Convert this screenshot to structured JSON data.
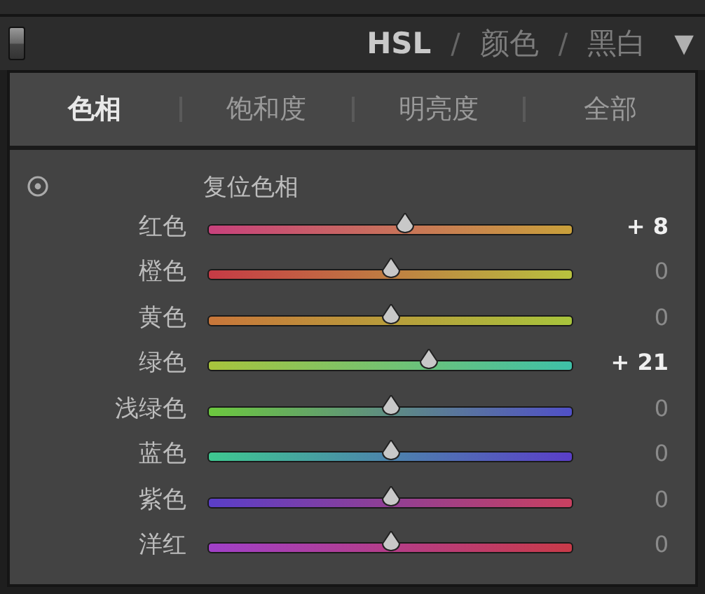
{
  "header": {
    "panel_switch": {
      "on": true
    },
    "modes": [
      {
        "label": "HSL",
        "selected": true
      },
      {
        "label": "颜色",
        "selected": false
      },
      {
        "label": "黑白",
        "selected": false
      }
    ],
    "separator": "/",
    "collapse_glyph": "▼"
  },
  "tabs": [
    {
      "label": "色相",
      "selected": true
    },
    {
      "label": "饱和度",
      "selected": false
    },
    {
      "label": "明亮度",
      "selected": false
    },
    {
      "label": "全部",
      "selected": false
    }
  ],
  "section": {
    "title": "复位色相"
  },
  "channels": [
    {
      "name": "红色",
      "level": 0.54,
      "reading": "+ 8",
      "changed": true
    },
    {
      "name": "橙色",
      "level": 0.5,
      "reading": "0",
      "changed": false
    },
    {
      "name": "黄色",
      "level": 0.5,
      "reading": "0",
      "changed": false
    },
    {
      "name": "绿色",
      "level": 0.605,
      "reading": "+ 21",
      "changed": true
    },
    {
      "name": "浅绿色",
      "level": 0.5,
      "reading": "0",
      "changed": false
    },
    {
      "name": "蓝色",
      "level": 0.5,
      "reading": "0",
      "changed": false
    },
    {
      "name": "紫色",
      "level": 0.5,
      "reading": "0",
      "changed": false
    },
    {
      "name": "洋红",
      "level": 0.5,
      "reading": "0",
      "changed": false
    }
  ]
}
